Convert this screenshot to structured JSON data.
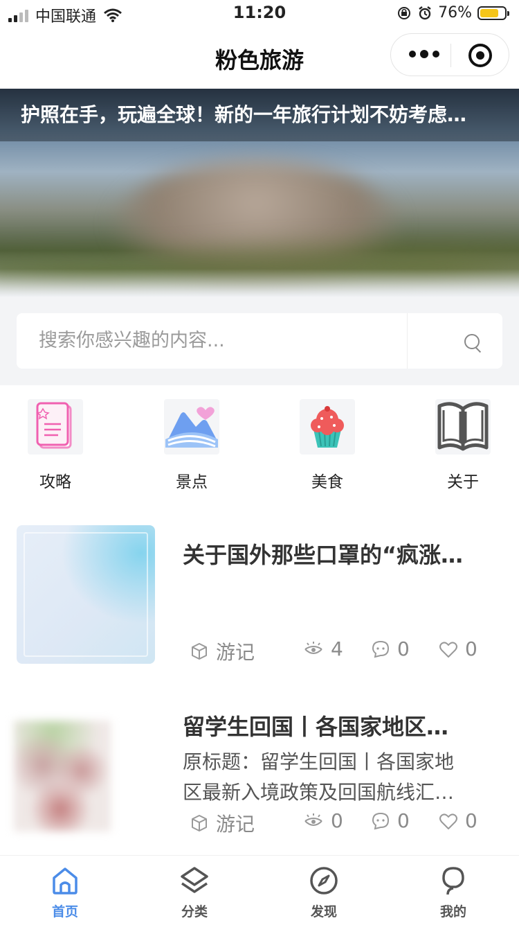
{
  "status_bar": {
    "carrier": "中国联通",
    "time": "11:20",
    "battery": "76%",
    "battery_level": 0.76
  },
  "header": {
    "title": "粉色旅游"
  },
  "banner": {
    "caption": "护照在手，玩遍全球！新的一年旅行计划不妨考虑…"
  },
  "search": {
    "placeholder": "搜索你感兴趣的内容..."
  },
  "categories": [
    {
      "label": "攻略",
      "icon": "strategy-doc-icon"
    },
    {
      "label": "景点",
      "icon": "scenery-icon"
    },
    {
      "label": "美食",
      "icon": "cupcake-icon"
    },
    {
      "label": "关于",
      "icon": "book-icon"
    }
  ],
  "articles": [
    {
      "title": "关于国外那些口罩的“疯涨…",
      "summary": "",
      "category": "游记",
      "views": "4",
      "comments": "0",
      "likes": "0"
    },
    {
      "title": "留学生回国丨各国家地区…",
      "summary_line1": "原标题：留学生回国丨各国家地",
      "summary_line2": "区最新入境政策及回国航线汇…",
      "category": "游记",
      "views": "0",
      "comments": "0",
      "likes": "0"
    }
  ],
  "tabbar": [
    {
      "label": "首页",
      "icon": "home-icon",
      "active": true
    },
    {
      "label": "分类",
      "icon": "layers-icon",
      "active": false
    },
    {
      "label": "发现",
      "icon": "compass-icon",
      "active": false
    },
    {
      "label": "我的",
      "icon": "profile-icon",
      "active": false
    }
  ],
  "colors": {
    "accent": "#4b8ce8",
    "search_bg": "#f3f4f6",
    "battery": "#f5c518"
  }
}
